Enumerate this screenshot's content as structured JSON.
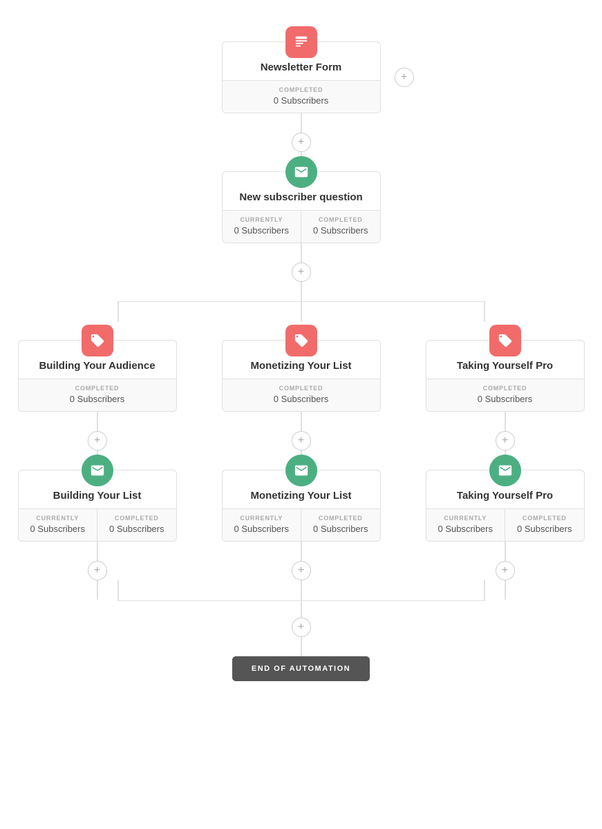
{
  "nodes": {
    "newsletter_form": {
      "title": "Newsletter Form",
      "icon_type": "red",
      "icon": "form",
      "stats": [
        {
          "label": "COMPLETED",
          "value": "0 Subscribers"
        }
      ]
    },
    "new_subscriber": {
      "title": "New subscriber question",
      "icon_type": "green",
      "icon": "email",
      "stats": [
        {
          "label": "CURRENTLY",
          "value": "0 Subscribers"
        },
        {
          "label": "COMPLETED",
          "value": "0 Subscribers"
        }
      ]
    },
    "building_audience": {
      "title": "Building Your Audience",
      "icon_type": "red",
      "icon": "tag",
      "stats": [
        {
          "label": "COMPLETED",
          "value": "0 Subscribers"
        }
      ]
    },
    "monetizing_list_1": {
      "title": "Monetizing Your List",
      "icon_type": "red",
      "icon": "tag",
      "stats": [
        {
          "label": "COMPLETED",
          "value": "0 Subscribers"
        }
      ]
    },
    "taking_pro_1": {
      "title": "Taking Yourself Pro",
      "icon_type": "red",
      "icon": "tag",
      "stats": [
        {
          "label": "COMPLETED",
          "value": "0 Subscribers"
        }
      ]
    },
    "building_list": {
      "title": "Building Your List",
      "icon_type": "green",
      "icon": "email",
      "stats": [
        {
          "label": "CURRENTLY",
          "value": "0 Subscribers"
        },
        {
          "label": "COMPLETED",
          "value": "0 Subscribers"
        }
      ]
    },
    "monetizing_list_2": {
      "title": "Monetizing Your List",
      "icon_type": "green",
      "icon": "email",
      "stats": [
        {
          "label": "CURRENTLY",
          "value": "0 Subscribers"
        },
        {
          "label": "COMPLETED",
          "value": "0 Subscribers"
        }
      ]
    },
    "taking_pro_2": {
      "title": "Taking Yourself Pro",
      "icon_type": "green",
      "icon": "email",
      "stats": [
        {
          "label": "CURRENTLY",
          "value": "0 Subscribers"
        },
        {
          "label": "COMPLETED",
          "value": "0 Subscribers"
        }
      ]
    }
  },
  "end": {
    "label": "END OF AUTOMATION"
  },
  "add_button": "+"
}
